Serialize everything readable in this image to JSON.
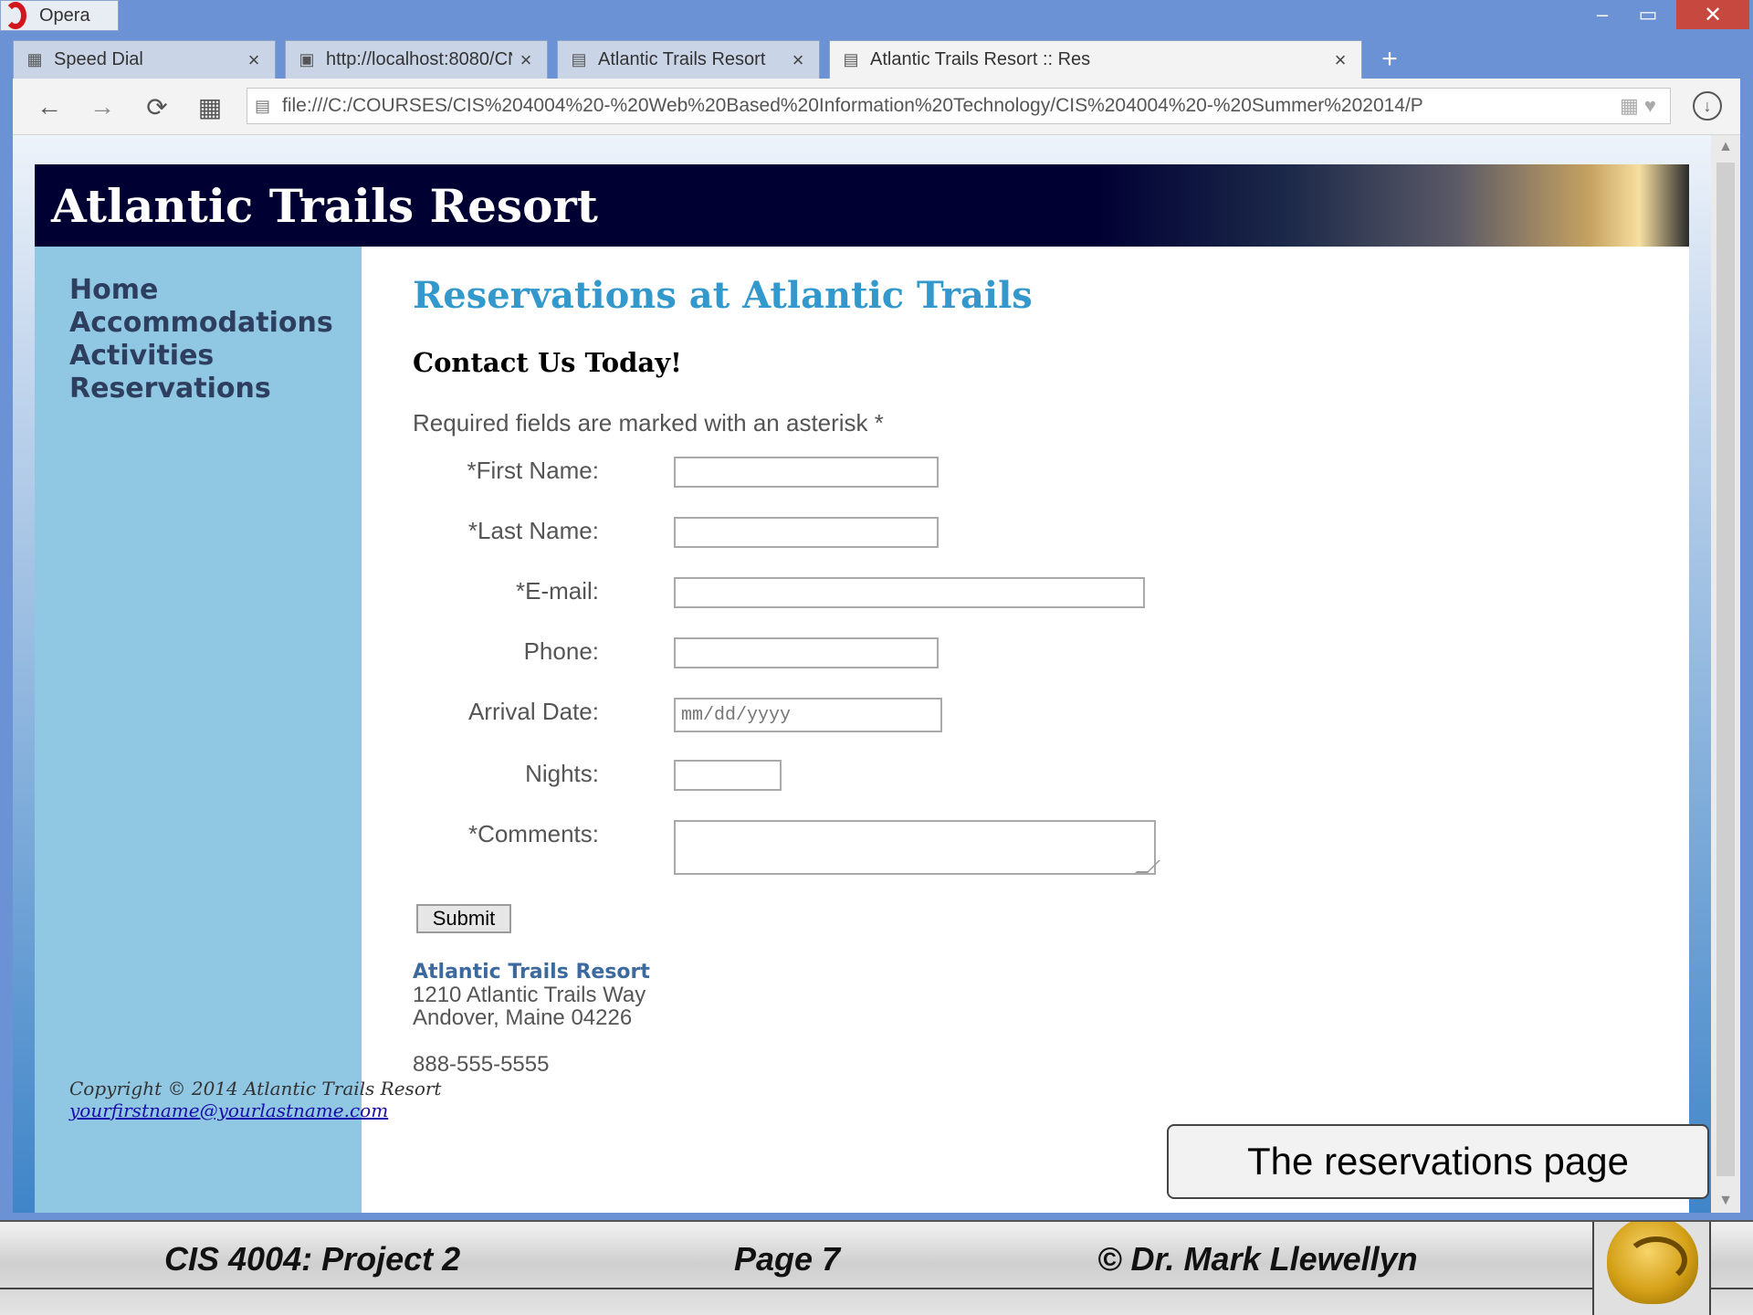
{
  "window": {
    "app_name": "Opera",
    "min_label": "–",
    "max_label": "▭",
    "close_label": "✕"
  },
  "tabs": [
    {
      "title": "Speed Dial",
      "icon": "speed-dial-icon"
    },
    {
      "title": "http://localhost:8080/CNT",
      "icon": "image-icon"
    },
    {
      "title": "Atlantic Trails Resort",
      "icon": "page-icon"
    },
    {
      "title": "Atlantic Trails Resort :: Res",
      "icon": "page-icon"
    }
  ],
  "active_tab_index": 3,
  "toolbar": {
    "back": "←",
    "forward": "→",
    "reload": "⟳",
    "speed_dial": "▦",
    "address": "file:///C:/COURSES/CIS%204004%20-%20Web%20Based%20Information%20Technology/CIS%204004%20-%20Summer%202014/P"
  },
  "site": {
    "title": "Atlantic Trails Resort",
    "nav": [
      "Home",
      "Accommodations",
      "Activities",
      "Reservations"
    ],
    "heading": "Reservations at Atlantic Trails",
    "subheading": "Contact Us Today!",
    "required_note": "Required fields are marked with an asterisk *",
    "form": {
      "first_name_label": "*First Name:",
      "last_name_label": "*Last Name:",
      "email_label": "*E-mail:",
      "phone_label": "Phone:",
      "arrival_label": "Arrival Date:",
      "arrival_placeholder": "mm/dd/yyyy",
      "nights_label": "Nights:",
      "comments_label": "*Comments:",
      "submit_label": "Submit"
    },
    "address": {
      "name": "Atlantic Trails Resort",
      "street": "1210 Atlantic Trails Way",
      "city": "Andover, Maine 04226",
      "phone": "888-555-5555"
    },
    "footer": {
      "copyright": "Copyright © 2014 Atlantic Trails Resort",
      "email": "yourfirstname@yourlastname.com"
    }
  },
  "callout": "The reservations page",
  "slide_footer": {
    "course": "CIS 4004:  Project 2",
    "page": "Page 7",
    "copyright": "© Dr. Mark Llewellyn"
  }
}
